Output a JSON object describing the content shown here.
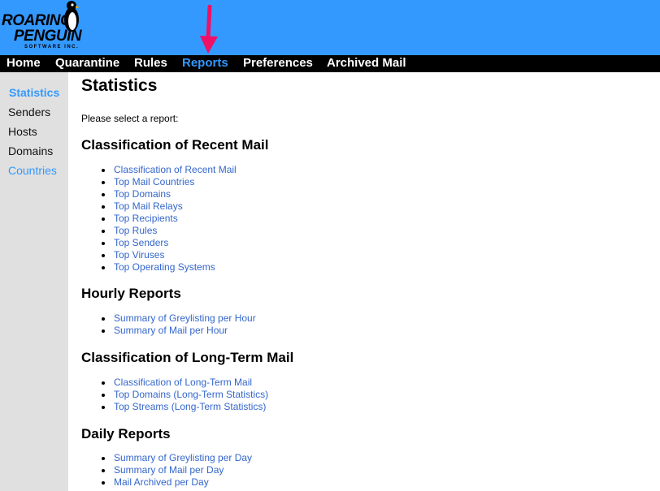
{
  "logo": {
    "line1": "ROARING",
    "line2": "PENGUIN",
    "line3": "SOFTWARE INC."
  },
  "nav": {
    "items": [
      {
        "label": "Home",
        "active": false
      },
      {
        "label": "Quarantine",
        "active": false
      },
      {
        "label": "Rules",
        "active": false
      },
      {
        "label": "Reports",
        "active": true
      },
      {
        "label": "Preferences",
        "active": false
      },
      {
        "label": "Archived Mail",
        "active": false
      }
    ]
  },
  "sidebar": {
    "items": [
      {
        "label": "Statistics"
      },
      {
        "label": "Senders"
      },
      {
        "label": "Hosts"
      },
      {
        "label": "Domains"
      },
      {
        "label": "Countries"
      }
    ]
  },
  "main": {
    "title": "Statistics",
    "intro": "Please select a report:",
    "sections": [
      {
        "heading": "Classification of Recent Mail",
        "links": [
          "Classification of Recent Mail",
          "Top Mail Countries",
          "Top Domains",
          "Top Mail Relays",
          "Top Recipients",
          "Top Rules",
          "Top Senders",
          "Top Viruses",
          "Top Operating Systems"
        ]
      },
      {
        "heading": "Hourly Reports",
        "links": [
          "Summary of Greylisting per Hour",
          "Summary of Mail per Hour"
        ]
      },
      {
        "heading": "Classification of Long-Term Mail",
        "links": [
          "Classification of Long-Term Mail",
          "Top Domains (Long-Term Statistics)",
          "Top Streams (Long-Term Statistics)"
        ]
      },
      {
        "heading": "Daily Reports",
        "links": [
          "Summary of Greylisting per Day",
          "Summary of Mail per Day",
          "Mail Archived per Day"
        ]
      }
    ]
  },
  "colors": {
    "header": "#3399ff",
    "nav": "#000000",
    "active": "#3399ff",
    "link": "#3366cc",
    "sidebar": "#e0e0e0",
    "arrow": "#ee1166"
  }
}
